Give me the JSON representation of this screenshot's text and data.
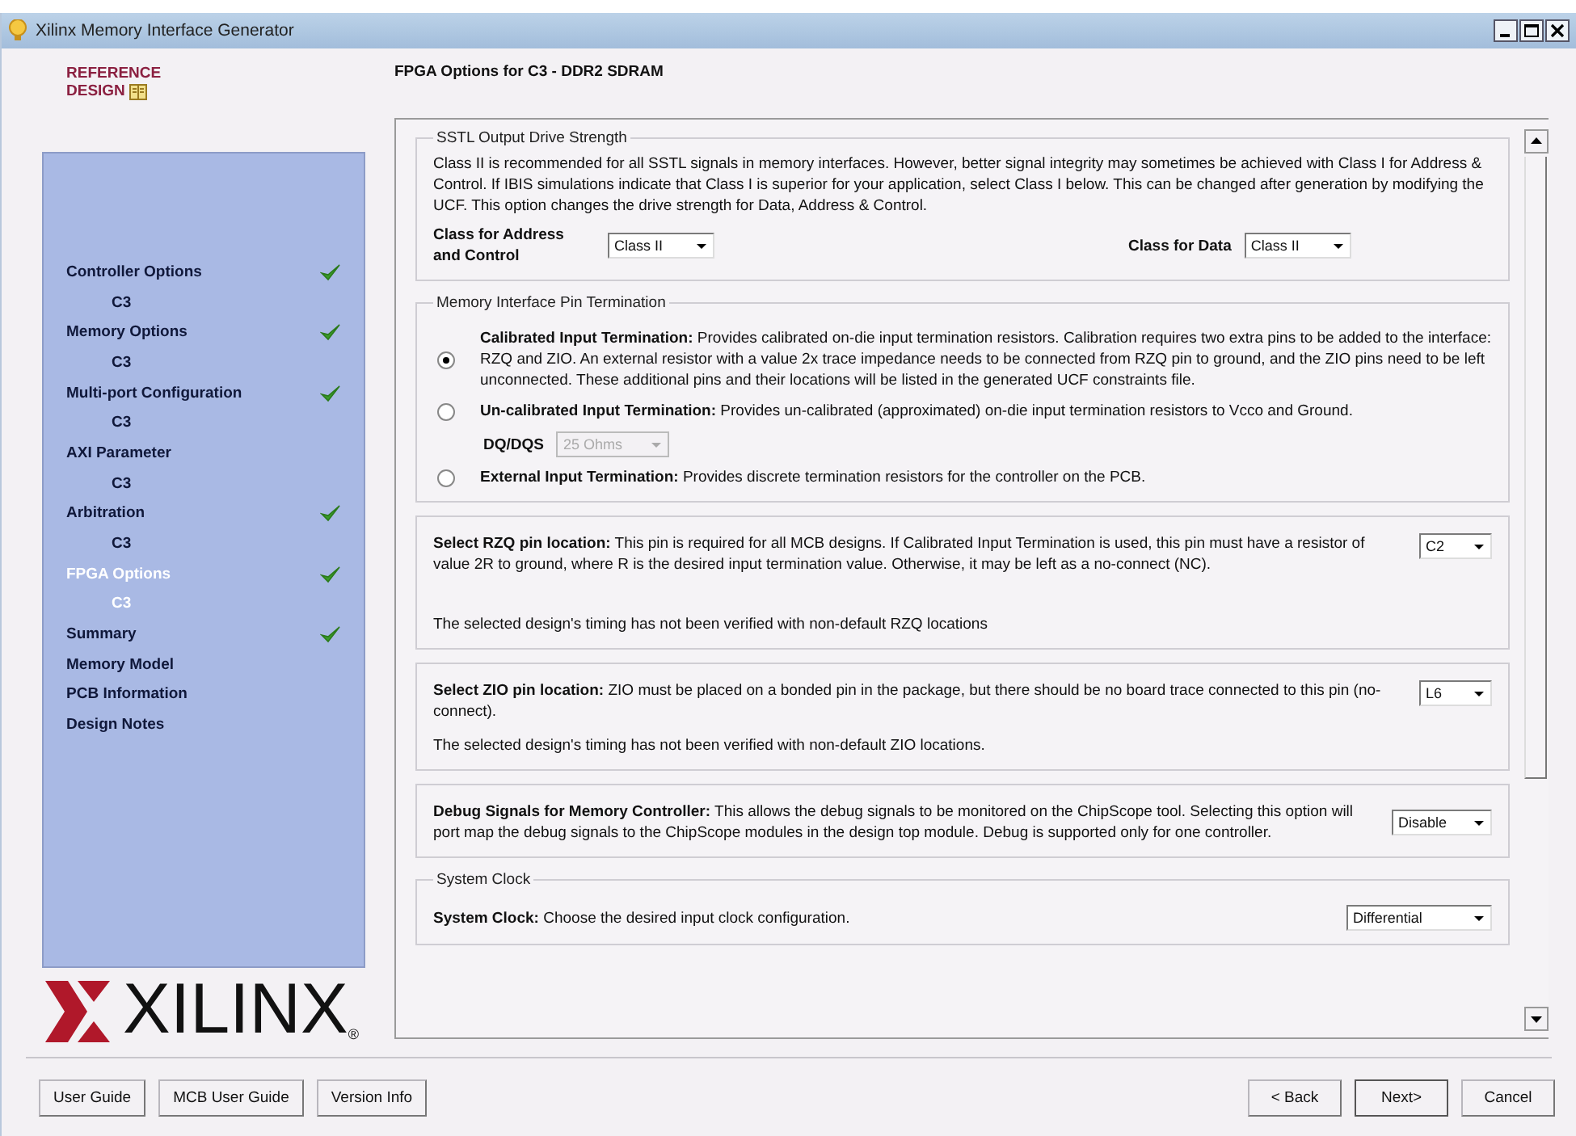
{
  "window": {
    "title": "Xilinx Memory Interface Generator"
  },
  "sidebar": {
    "reference_lines": [
      "REFERENCE",
      "DESIGN"
    ],
    "nav": [
      {
        "label": "Controller Options",
        "done": true,
        "selected": false,
        "children": [
          {
            "label": "C3",
            "selected": false
          }
        ]
      },
      {
        "label": "Memory Options",
        "done": true,
        "selected": false,
        "children": [
          {
            "label": "C3",
            "selected": false
          }
        ]
      },
      {
        "label": "Multi-port Configuration",
        "done": true,
        "selected": false,
        "children": [
          {
            "label": "C3",
            "selected": false
          }
        ]
      },
      {
        "label": "AXI Parameter",
        "done": false,
        "selected": false,
        "children": [
          {
            "label": "C3",
            "selected": false
          }
        ]
      },
      {
        "label": "Arbitration",
        "done": true,
        "selected": false,
        "children": [
          {
            "label": "C3",
            "selected": false
          }
        ]
      },
      {
        "label": "FPGA Options",
        "done": true,
        "selected": true,
        "children": [
          {
            "label": "C3",
            "selected": true
          }
        ]
      },
      {
        "label": "Summary",
        "done": true,
        "selected": false
      },
      {
        "label": "Memory Model",
        "done": false,
        "selected": false
      },
      {
        "label": "PCB Information",
        "done": false,
        "selected": false
      },
      {
        "label": "Design Notes",
        "done": false,
        "selected": false
      }
    ],
    "logo": {
      "wordmark": "XILINX",
      "mark": "®"
    }
  },
  "page_title": "FPGA Options for C3 - DDR2 SDRAM",
  "sstl": {
    "legend": "SSTL Output Drive Strength",
    "text": "Class II is recommended for all SSTL signals in memory interfaces. However, better signal integrity may sometimes be achieved with Class I for Address & Control. If IBIS simulations indicate that Class I is superior for your application, select Class I below. This can be changed after generation by modifying the UCF. This option changes the drive strength for Data, Address & Control.",
    "fields": [
      {
        "label": "Class for Address and Control",
        "value": "Class II"
      },
      {
        "label": "Class for Data",
        "value": "Class II"
      }
    ]
  },
  "termination": {
    "legend": "Memory Interface Pin Termination",
    "options": [
      {
        "text": "**Calibrated Input Termination:** Provides calibrated on-die input termination resistors. Calibration requires two extra pins to be added to the interface: RZQ and ZIO. An external resistor with a value 2x trace impedance needs to be connected from RZQ pin to ground, and the ZIO pins need to be left unconnected. These additional pins and their locations will be listed in the generated UCF constraints file.",
        "selected": true
      },
      {
        "text": "**Un-calibrated Input Termination:** Provides un-calibrated (approximated) on-die input termination resistors to Vcco and Ground.",
        "selected": false,
        "sub": {
          "label": "DQ/DQS",
          "value": "25 Ohms",
          "disabled": true
        }
      },
      {
        "text": "**External Input Termination:** Provides discrete termination resistors for the controller on the PCB.",
        "selected": false
      }
    ]
  },
  "rzq": {
    "text": "**Select RZQ pin location:** This pin is required for all MCB designs. If Calibrated Input Termination is used, this pin must have a resistor of value 2R to ground, where R is the desired input termination value. Otherwise, it may be left as a no-connect (NC).",
    "value": "C2",
    "note": "The selected design's timing has not been verified with non-default RZQ locations"
  },
  "zio": {
    "text": "**Select ZIO pin location:** ZIO must be placed on a bonded pin in the package, but there should be no board trace connected to this pin (no-connect).",
    "value": "L6",
    "note": "The selected design's timing has not been verified with non-default ZIO locations."
  },
  "debug": {
    "text": "**Debug Signals for Memory Controller:** This allows the debug signals to be monitored on the ChipScope tool. Selecting this option will port map the debug signals to the ChipScope modules in the design top module. Debug is supported only for one controller.",
    "value": "Disable"
  },
  "system_clock": {
    "legend": "System Clock",
    "text": "**System Clock:** Choose the desired input clock configuration.",
    "value": "Differential"
  },
  "footer": {
    "left_buttons": [
      "User Guide",
      "MCB User Guide",
      "Version Info"
    ],
    "right_buttons": [
      {
        "label": "< Back",
        "default": false
      },
      {
        "label": "Next>",
        "default": true
      },
      {
        "label": "Cancel",
        "default": false
      }
    ]
  }
}
